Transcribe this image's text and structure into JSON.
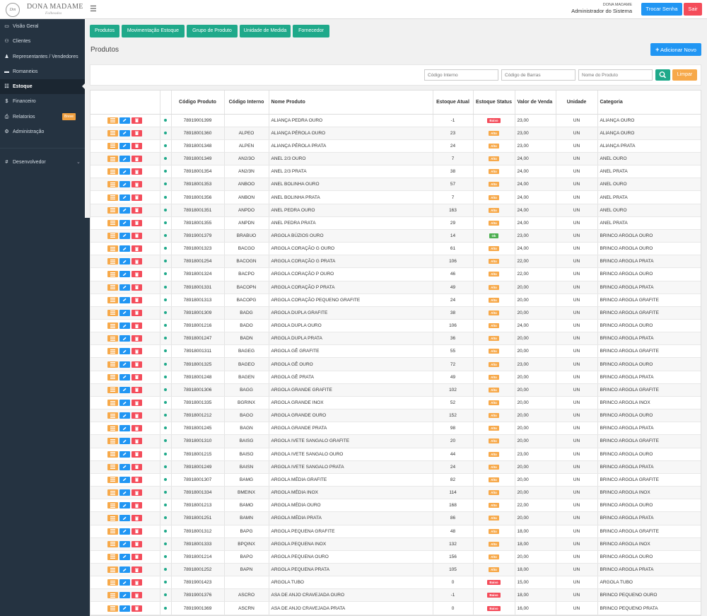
{
  "header": {
    "logo_mark": "Dm",
    "logo_name": "DONA MADAME",
    "logo_sub": "Folheados",
    "user_small": "DONA MADAME",
    "user_role": "Administrador do Sistema",
    "change_password": "Trocar Senha",
    "logout": "Sair"
  },
  "sidebar": {
    "items": [
      {
        "icon": "monitor-icon",
        "label": "Visão Geral"
      },
      {
        "icon": "users-icon",
        "label": "Clientes"
      },
      {
        "icon": "user-tie-icon",
        "label": "Representantes / Vendedores"
      },
      {
        "icon": "truck-icon",
        "label": "Romaneios"
      },
      {
        "icon": "table-icon",
        "label": "Estoque",
        "active": true
      },
      {
        "icon": "dollar-icon",
        "label": "Financeiro"
      },
      {
        "icon": "print-icon",
        "label": "Relatorios",
        "badge": "Breve"
      },
      {
        "icon": "gear-icon",
        "label": "Administração"
      }
    ],
    "dev": {
      "icon": "hash-icon",
      "label": "Desenvolvedor"
    }
  },
  "tabs": [
    "Produtos",
    "Movimentação Estoque",
    "Grupo de Produto",
    "Unidade de Medida",
    "Fornecedor"
  ],
  "page_title": "Produtos",
  "add_button": "Adicionar Novo",
  "filters": {
    "internal_code_placeholder": "Código Interno",
    "barcode_placeholder": "Código de Barras",
    "product_name_placeholder": "Nome do Produto",
    "clear": "Limpar"
  },
  "table": {
    "headers": [
      "Código Produto",
      "Código Interno",
      "Nome Produto",
      "Estoque Atual",
      "Estoque Status",
      "Valor de Venda",
      "Unidade",
      "Categoria"
    ],
    "rows": [
      [
        "78919001399",
        "",
        "ALIANÇA PEDRA OURO",
        "-1",
        "Baixo",
        "23,00",
        "UN",
        "ALIANÇA OURO"
      ],
      [
        "78918001360",
        "ALPEO",
        "ALIANÇA PÉROLA OURO",
        "23",
        "Alto",
        "23,00",
        "UN",
        "ALIANÇA OURO"
      ],
      [
        "78918001348",
        "ALPEN",
        "ALIANÇA PÉROLA PRATA",
        "24",
        "Alto",
        "23,00",
        "UN",
        "ALIANÇA PRATA"
      ],
      [
        "78918001349",
        "AN2/3O",
        "ANEL 2/3 OURO",
        "7",
        "Alto",
        "24,00",
        "UN",
        "ANEL OURO"
      ],
      [
        "78918001354",
        "AN2/3N",
        "ANEL 2/3 PRATA",
        "38",
        "Alto",
        "24,00",
        "UN",
        "ANEL PRATA"
      ],
      [
        "78918001353",
        "ANBOO",
        "ANEL BOLINHA OURO",
        "57",
        "Alto",
        "24,00",
        "UN",
        "ANEL OURO"
      ],
      [
        "78918001356",
        "ANBON",
        "ANEL BOLINHA PRATA",
        "7",
        "Alto",
        "24,00",
        "UN",
        "ANEL PRATA"
      ],
      [
        "78918001351",
        "ANPDO",
        "ANEL PEDRA OURO",
        "163",
        "Alto",
        "24,00",
        "UN",
        "ANEL OURO"
      ],
      [
        "78918001355",
        "ANPDN",
        "ANEL PEDRA PRATA",
        "29",
        "Alto",
        "24,00",
        "UN",
        "ANEL PRATA"
      ],
      [
        "78919001379",
        "BRABUO",
        "ARGOLA BÚZIOS OURO",
        "14",
        "Ok",
        "23,00",
        "UN",
        "BRINCO ARGOLA OURO"
      ],
      [
        "78918001323",
        "BACGO",
        "ARGOLA CORAÇÃO G OURO",
        "61",
        "Alto",
        "24,00",
        "UN",
        "BRINCO ARGOLA OURO"
      ],
      [
        "78918001254",
        "BACOGN",
        "ARGOLA CORAÇÃO G PRATA",
        "106",
        "Alto",
        "22,00",
        "UN",
        "BRINCO ARGOLA PRATA"
      ],
      [
        "78918001324",
        "BACPO",
        "ARGOLA CORAÇÃO P OURO",
        "46",
        "Alto",
        "22,00",
        "UN",
        "BRINCO ARGOLA OURO"
      ],
      [
        "78918001331",
        "BACOPN",
        "ARGOLA CORAÇÃO P PRATA",
        "49",
        "Alto",
        "20,00",
        "UN",
        "BRINCO ARGOLA PRATA"
      ],
      [
        "78918001313",
        "BACOPG",
        "ARGOLA CORAÇÃO PEQUENO GRAFITE",
        "24",
        "Alto",
        "20,00",
        "UN",
        "BRINCO ARGOLA GRAFITE"
      ],
      [
        "78918001309",
        "BADG",
        "ARGOLA DUPLA GRAFITE",
        "38",
        "Alto",
        "20,00",
        "UN",
        "BRINCO ARGOLA GRAFITE"
      ],
      [
        "78918001216",
        "BADO",
        "ARGOLA DUPLA OURO",
        "106",
        "Alto",
        "24,00",
        "UN",
        "BRINCO ARGOLA OURO"
      ],
      [
        "78918001247",
        "BADN",
        "ARGOLA DUPLA PRATA",
        "36",
        "Alto",
        "20,00",
        "UN",
        "BRINCO ARGOLA PRATA"
      ],
      [
        "78918001311",
        "BAGEG",
        "ARGOLA GÊ GRAFITE",
        "55",
        "Alto",
        "20,00",
        "UN",
        "BRINCO ARGOLA GRAFITE"
      ],
      [
        "78918001325",
        "BAGEO",
        "ARGOLA GÊ OURO",
        "72",
        "Alto",
        "23,00",
        "UN",
        "BRINCO ARGOLA OURO"
      ],
      [
        "78918001248",
        "BAGEN",
        "ARGOLA GÊ PRATA",
        "49",
        "Alto",
        "20,00",
        "UN",
        "BRINCO ARGOLA PRATA"
      ],
      [
        "78918001306",
        "BAGG",
        "ARGOLA GRANDE GRAFITE",
        "102",
        "Alto",
        "20,00",
        "UN",
        "BRINCO ARGOLA GRAFITE"
      ],
      [
        "78918001335",
        "BGRINX",
        "ARGOLA GRANDE INOX",
        "52",
        "Alto",
        "20,00",
        "UN",
        "BRINCO ARGOLA INOX"
      ],
      [
        "78918001212",
        "BAGO",
        "ARGOLA GRANDE OURO",
        "152",
        "Alto",
        "20,00",
        "UN",
        "BRINCO ARGOLA OURO"
      ],
      [
        "78918001245",
        "BAGN",
        "ARGOLA GRANDE PRATA",
        "98",
        "Alto",
        "20,00",
        "UN",
        "BRINCO ARGOLA PRATA"
      ],
      [
        "78918001310",
        "BAISG",
        "ARGOLA IVETE SANGALO GRAFITE",
        "20",
        "Alto",
        "20,00",
        "UN",
        "BRINCO ARGOLA GRAFITE"
      ],
      [
        "78918001215",
        "BAISO",
        "ARGOLA IVETE SANGALO OURO",
        "44",
        "Alto",
        "23,00",
        "UN",
        "BRINCO ARGOLA OURO"
      ],
      [
        "78918001249",
        "BAISN",
        "ARGOLA IVETE SANGALO PRATA",
        "24",
        "Alto",
        "20,00",
        "UN",
        "BRINCO ARGOLA PRATA"
      ],
      [
        "78918001307",
        "BAMG",
        "ARGOLA MÉDIA GRAFITE",
        "82",
        "Alto",
        "20,00",
        "UN",
        "BRINCO ARGOLA GRAFITE"
      ],
      [
        "78918001334",
        "BMEINX",
        "ARGOLA MÉDIA INOX",
        "114",
        "Alto",
        "20,00",
        "UN",
        "BRINCO ARGOLA INOX"
      ],
      [
        "78918001213",
        "BAMO",
        "ARGOLA MÉDIA OURO",
        "168",
        "Alto",
        "22,00",
        "UN",
        "BRINCO ARGOLA OURO"
      ],
      [
        "78918001251",
        "BAMN",
        "ARGOLA MÉDIA PRATA",
        "86",
        "Alto",
        "20,00",
        "UN",
        "BRINCO ARGOLA PRATA"
      ],
      [
        "78918001312",
        "BAPG",
        "ARGOLA PEQUENA GRAFITE",
        "48",
        "Alto",
        "18,00",
        "UN",
        "BRINCO ARGOLA GRAFITE"
      ],
      [
        "78918001333",
        "BPQINX",
        "ARGOLA PEQUENA INOX",
        "132",
        "Alto",
        "18,00",
        "UN",
        "BRINCO ARGOLA INOX"
      ],
      [
        "78918001214",
        "BAPO",
        "ARGOLA PEQUENA OURO",
        "156",
        "Alto",
        "20,00",
        "UN",
        "BRINCO ARGOLA OURO"
      ],
      [
        "78918001252",
        "BAPN",
        "ARGOLA PEQUENA PRATA",
        "105",
        "Alto",
        "18,00",
        "UN",
        "BRINCO ARGOLA PRATA"
      ],
      [
        "78919001423",
        "",
        "ARGOLA TUBO",
        "0",
        "Baixo",
        "15,00",
        "UN",
        "ARGOLA TUBO"
      ],
      [
        "78919001376",
        "ASCRO",
        "ASA DE ANJO CRAVEJADA OURO",
        "-1",
        "Baixo",
        "18,00",
        "UN",
        "BRINCO PEQUENO OURO"
      ],
      [
        "78919001369",
        "ASCRN",
        "ASA DE ANJO CRAVEJADA PRATA",
        "0",
        "Baixo",
        "16,00",
        "UN",
        "BRINCO PEQUENO PRATA"
      ]
    ]
  },
  "colors": {
    "sidebar": "#253341",
    "teal": "#1fa98a",
    "blue": "#2196f3",
    "orange": "#f7a94a",
    "red": "#f44c5a",
    "green": "#4caf50"
  }
}
